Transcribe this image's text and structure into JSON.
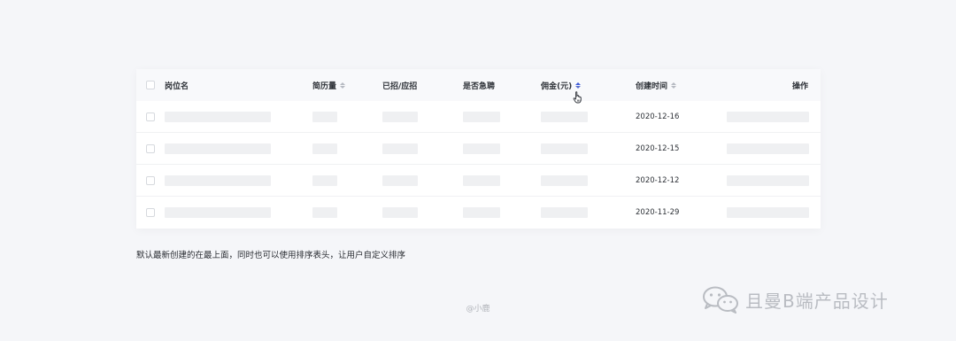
{
  "table": {
    "columns": [
      {
        "key": "name",
        "label": "岗位名",
        "sortable": false
      },
      {
        "key": "resumes",
        "label": "简历量",
        "sortable": true
      },
      {
        "key": "hired",
        "label": "已招/应招",
        "sortable": false
      },
      {
        "key": "urgent",
        "label": "是否急聘",
        "sortable": false
      },
      {
        "key": "commission",
        "label": "佣金(元)",
        "sortable": true,
        "sort": "ascending"
      },
      {
        "key": "created",
        "label": "创建时间",
        "sortable": true
      },
      {
        "key": "actions",
        "label": "操作",
        "sortable": false
      }
    ],
    "rows": [
      {
        "created": "2020-12-16"
      },
      {
        "created": "2020-12-15"
      },
      {
        "created": "2020-12-12"
      },
      {
        "created": "2020-11-29"
      }
    ]
  },
  "caption": "默认最新创建的在最上面，同时也可以使用排序表头，让用户自定义排序",
  "credit": "@小鹿",
  "watermark": {
    "text": "且曼B端产品设计",
    "icon": "wechat-icon"
  },
  "colors": {
    "accent": "#3d5bd9",
    "placeholder": "#eff0f2",
    "background": "#f5f6f9"
  }
}
